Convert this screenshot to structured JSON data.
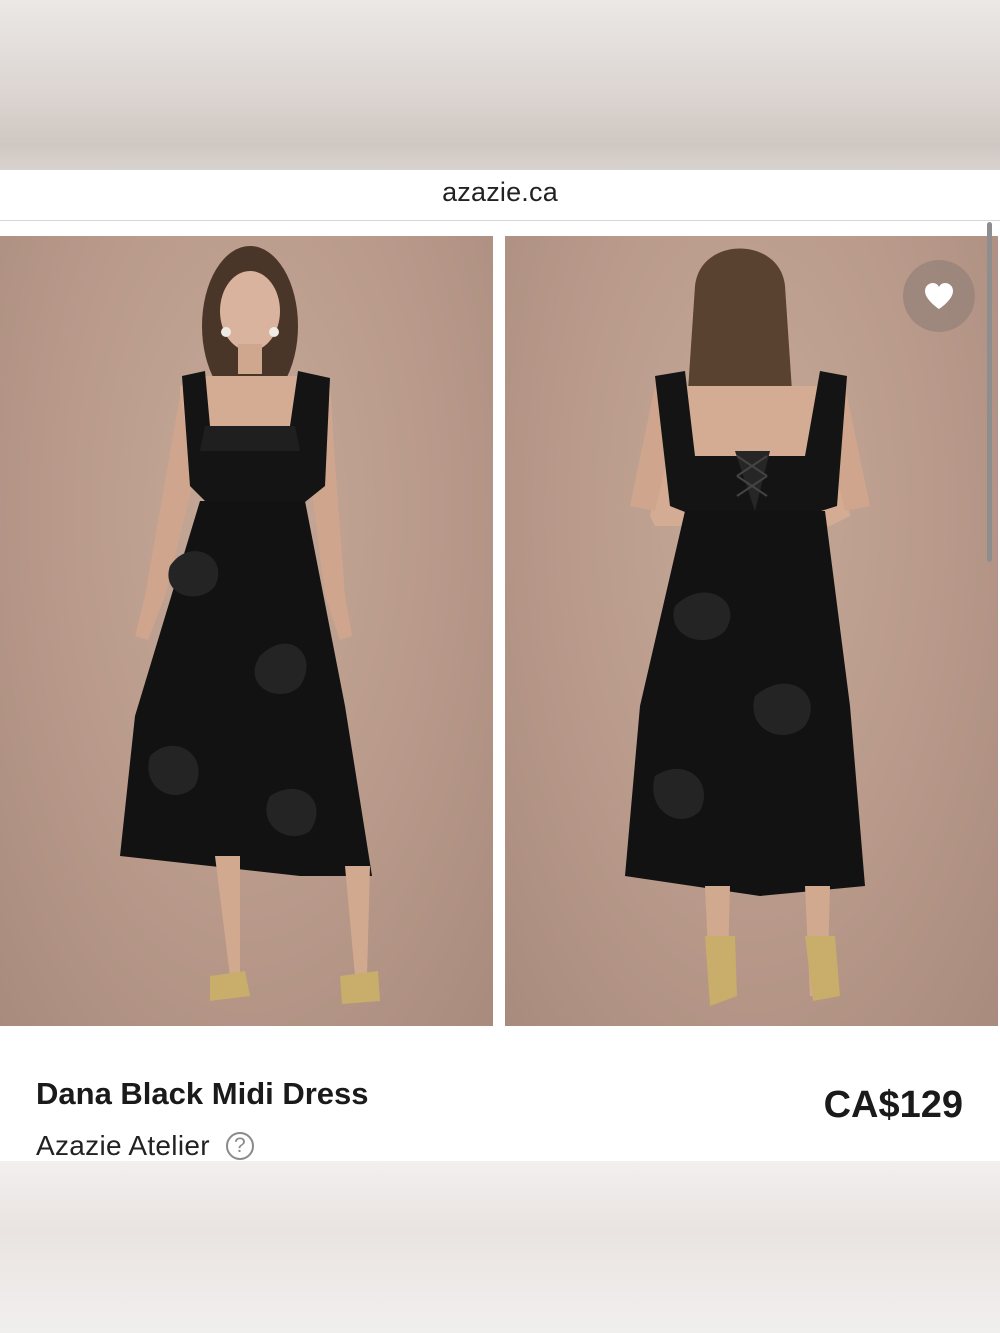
{
  "browser": {
    "url": "azazie.ca"
  },
  "gallery": {
    "images": [
      {
        "icon": "dress-front-photo"
      },
      {
        "icon": "dress-back-photo"
      }
    ],
    "favorite_icon": "heart-icon"
  },
  "product": {
    "name": "Dana Black Midi Dress",
    "brand": "Azazie Atelier",
    "help_icon": "?",
    "price": "CA$129"
  },
  "colors": {
    "backdrop": "#b8998a",
    "dress": "#141414",
    "heels": "#c9ad6a"
  }
}
